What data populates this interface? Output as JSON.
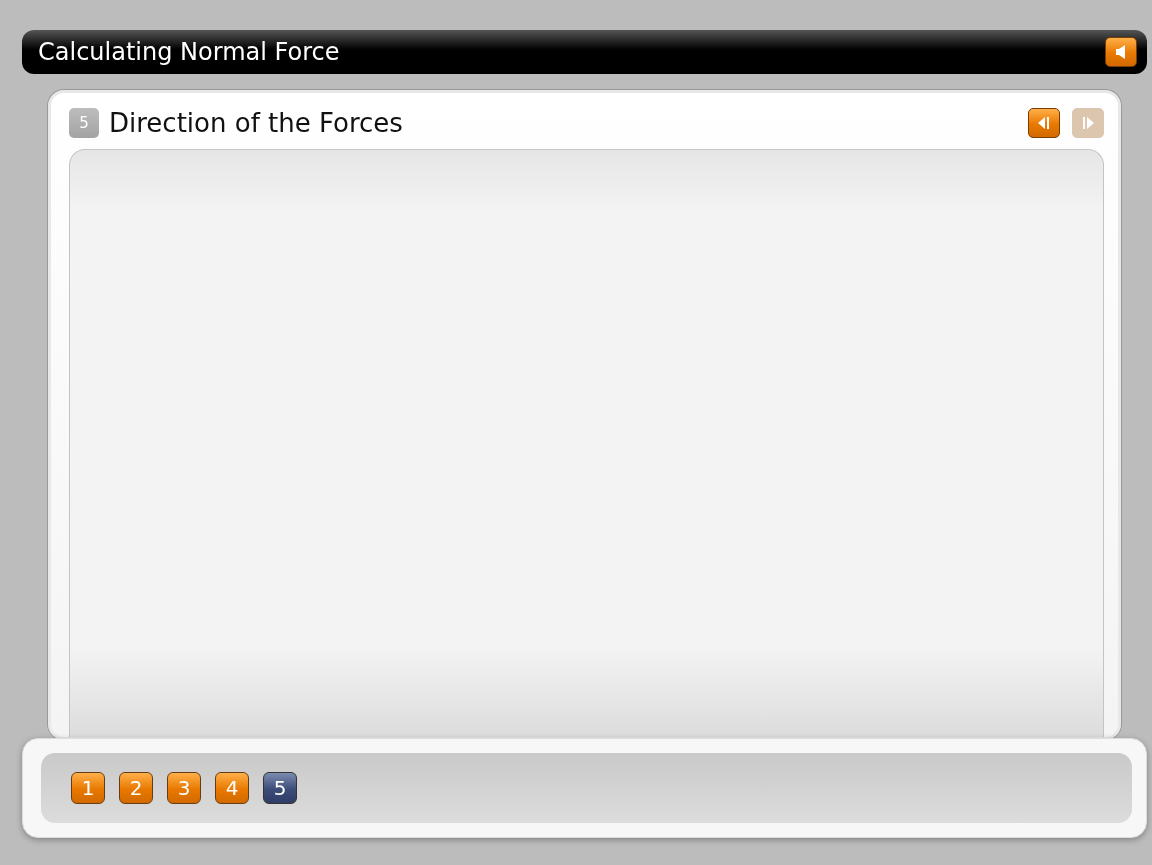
{
  "title": "Calculating Normal Force",
  "sound": {
    "on": true
  },
  "slide": {
    "number": "5",
    "title": "Direction of the Forces"
  },
  "nav": {
    "prev_disabled": false,
    "next_disabled": true
  },
  "pages": [
    {
      "label": "1",
      "selected": false
    },
    {
      "label": "2",
      "selected": false
    },
    {
      "label": "3",
      "selected": false
    },
    {
      "label": "4",
      "selected": false
    },
    {
      "label": "5",
      "selected": true
    }
  ]
}
